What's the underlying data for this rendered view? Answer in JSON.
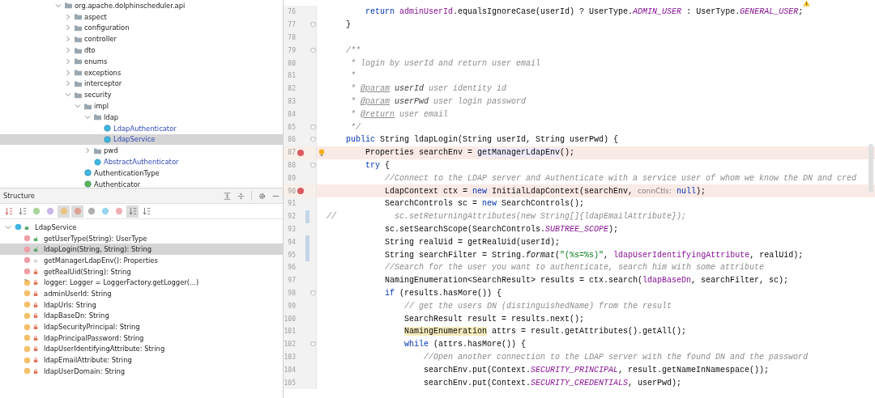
{
  "project_tree": [
    {
      "label": "org.apache.dolphinscheduler.api",
      "kind": "folder",
      "expanded": true,
      "selected": false,
      "children": [
        {
          "label": "aspect",
          "kind": "folder",
          "expanded": false,
          "selected": false
        },
        {
          "label": "configuration",
          "kind": "folder",
          "expanded": false,
          "selected": false
        },
        {
          "label": "controller",
          "kind": "folder",
          "expanded": false,
          "selected": false
        },
        {
          "label": "dto",
          "kind": "folder",
          "expanded": false,
          "selected": false
        },
        {
          "label": "enums",
          "kind": "folder",
          "expanded": false,
          "selected": false
        },
        {
          "label": "exceptions",
          "kind": "folder",
          "expanded": false,
          "selected": false
        },
        {
          "label": "interceptor",
          "kind": "folder",
          "expanded": false,
          "selected": false
        },
        {
          "label": "security",
          "kind": "folder",
          "expanded": true,
          "selected": false,
          "children": [
            {
              "label": "impl",
              "kind": "folder",
              "expanded": true,
              "selected": false,
              "children": [
                {
                  "label": "ldap",
                  "kind": "folder",
                  "expanded": true,
                  "selected": false,
                  "children": [
                    {
                      "label": "LdapAuthenticator",
                      "kind": "class",
                      "selected": false
                    },
                    {
                      "label": "LdapService",
                      "kind": "class",
                      "selected": true
                    }
                  ]
                },
                {
                  "label": "pwd",
                  "kind": "folder",
                  "expanded": false,
                  "selected": false
                },
                {
                  "label": "AbstractAuthenticator",
                  "kind": "abstract",
                  "selected": false
                }
              ]
            },
            {
              "label": "AuthenticationType",
              "kind": "enum",
              "selected": false
            },
            {
              "label": "Authenticator",
              "kind": "interface",
              "selected": false
            }
          ]
        }
      ]
    }
  ],
  "structure": {
    "title": "Structure",
    "toolbar": [
      {
        "kind": "sort-alpha",
        "selected": false
      },
      {
        "kind": "sort-visibility",
        "selected": false
      },
      {
        "kind": "inherited",
        "selected": false
      },
      {
        "kind": "properties",
        "selected": false
      },
      {
        "kind": "fields",
        "selected": true
      },
      {
        "kind": "non-public",
        "selected": true
      },
      {
        "kind": "anonymous",
        "selected": false
      },
      {
        "kind": "lambda-circle",
        "selected": false
      },
      {
        "kind": "lambda",
        "selected": false
      },
      {
        "kind": "autoscroll-to",
        "selected": true
      },
      {
        "kind": "autoscroll-from",
        "selected": false
      }
    ],
    "root": {
      "label": "LdapService",
      "expanded": true,
      "children": [
        {
          "label": "getUserType(String): UserType",
          "kind": "method",
          "public": true,
          "private": false,
          "selected": false
        },
        {
          "label": "ldapLogin(String, String): String",
          "kind": "method",
          "public": true,
          "private": false,
          "selected": true
        },
        {
          "label": "getManagerLdapEnv(): Properties",
          "kind": "method",
          "public": false,
          "private": false,
          "selected": false
        },
        {
          "label": "getRealUid(String): String",
          "kind": "method",
          "public": false,
          "private": true,
          "selected": false
        },
        {
          "label": "logger: Logger = LoggerFactory.getLogger(...)",
          "kind": "static-field",
          "public": false,
          "private": true,
          "selected": false
        },
        {
          "label": "adminUserId: String",
          "kind": "field",
          "public": false,
          "private": true,
          "selected": false
        },
        {
          "label": "ldapUrls: String",
          "kind": "field",
          "public": false,
          "private": true,
          "selected": false
        },
        {
          "label": "ldapBaseDn: String",
          "kind": "field",
          "public": false,
          "private": true,
          "selected": false
        },
        {
          "label": "ldapSecurityPrincipal: String",
          "kind": "field",
          "public": false,
          "private": true,
          "selected": false
        },
        {
          "label": "ldapPrincipalPassword: String",
          "kind": "field",
          "public": false,
          "private": true,
          "selected": false
        },
        {
          "label": "ldapUserIdentifyingAttribute: String",
          "kind": "field",
          "public": false,
          "private": true,
          "selected": false
        },
        {
          "label": "ldapEmailAttribute: String",
          "kind": "field",
          "public": false,
          "private": true,
          "selected": false
        },
        {
          "label": "ldapUserDomain: String",
          "kind": "field",
          "public": false,
          "private": true,
          "selected": false
        }
      ]
    }
  },
  "editor": {
    "lines": [
      {
        "number": "76",
        "breakpoint": false,
        "changed": false,
        "fold": false,
        "bulb": false,
        "tokens": [
          {
            "kind": "kw",
            "text": "        return"
          },
          {
            "kind": "field",
            "text": " adminUserId"
          },
          {
            "kind": "plain",
            "text": ".equalsIgnoreCase(userId) ? UserType."
          },
          {
            "kind": "static",
            "text": "ADMIN_USER"
          },
          {
            "kind": "plain",
            "text": " : UserType."
          },
          {
            "kind": "static",
            "text": "GENERAL_USER"
          },
          {
            "kind": "plain",
            "text": ";"
          }
        ]
      },
      {
        "number": "77",
        "breakpoint": false,
        "changed": false,
        "fold": true,
        "bulb": false,
        "tokens": [
          {
            "kind": "plain",
            "text": "    }"
          }
        ]
      },
      {
        "number": "78",
        "breakpoint": false,
        "changed": false,
        "fold": false,
        "bulb": false
      },
      {
        "number": "79",
        "breakpoint": false,
        "changed": false,
        "fold": true,
        "bulb": false,
        "tokens": [
          {
            "kind": "doc",
            "text": "    /**"
          }
        ]
      },
      {
        "number": "80",
        "breakpoint": false,
        "changed": false,
        "fold": false,
        "bulb": false,
        "tokens": [
          {
            "kind": "doc",
            "text": "     * login by userId and return user email"
          }
        ]
      },
      {
        "number": "81",
        "breakpoint": false,
        "changed": false,
        "fold": false,
        "bulb": false,
        "tokens": [
          {
            "kind": "doc",
            "text": "     *"
          }
        ]
      },
      {
        "number": "82",
        "breakpoint": false,
        "changed": false,
        "fold": false,
        "bulb": false,
        "tokens": [
          {
            "kind": "doc",
            "text": "     * "
          },
          {
            "kind": "doctag",
            "text": "@param"
          },
          {
            "kind": "docparam",
            "text": " userId"
          },
          {
            "kind": "doc",
            "text": " user identity id"
          }
        ]
      },
      {
        "number": "83",
        "breakpoint": false,
        "changed": false,
        "fold": false,
        "bulb": false,
        "tokens": [
          {
            "kind": "doc",
            "text": "     * "
          },
          {
            "kind": "doctag",
            "text": "@param"
          },
          {
            "kind": "docparam",
            "text": " userPwd"
          },
          {
            "kind": "doc",
            "text": " user login password"
          }
        ]
      },
      {
        "number": "84",
        "breakpoint": false,
        "changed": false,
        "fold": false,
        "bulb": false,
        "tokens": [
          {
            "kind": "doc",
            "text": "     * "
          },
          {
            "kind": "doctag",
            "text": "@return"
          },
          {
            "kind": "doc",
            "text": " user email"
          }
        ]
      },
      {
        "number": "85",
        "breakpoint": false,
        "changed": false,
        "fold": true,
        "bulb": false,
        "tokens": [
          {
            "kind": "doc",
            "text": "     */"
          }
        ]
      },
      {
        "number": "86",
        "breakpoint": false,
        "changed": false,
        "fold": true,
        "bulb": false,
        "tokens": [
          {
            "kind": "kw",
            "text": "    public"
          },
          {
            "kind": "plain",
            "text": " String ldapLogin(String userId, String userPwd) {"
          }
        ]
      },
      {
        "number": "87",
        "breakpoint": true,
        "changed": false,
        "fold": false,
        "bulb": true,
        "tokens": [
          {
            "kind": "plain",
            "text": "        Properties searchEnv = "
          },
          {
            "kind": "usage",
            "text": "getManagerLdapEnv"
          },
          {
            "kind": "plain",
            "text": "();"
          }
        ]
      },
      {
        "number": "88",
        "breakpoint": false,
        "changed": false,
        "fold": true,
        "bulb": false,
        "tokens": [
          {
            "kind": "kw",
            "text": "        try"
          },
          {
            "kind": "plain",
            "text": " {"
          }
        ]
      },
      {
        "number": "89",
        "breakpoint": false,
        "changed": false,
        "fold": false,
        "bulb": false,
        "tokens": [
          {
            "kind": "comment",
            "text": "            //Connect to the LDAP server and Authenticate with a service user of whom we know the DN and cred"
          }
        ]
      },
      {
        "number": "90",
        "breakpoint": true,
        "changed": false,
        "fold": false,
        "bulb": false,
        "tokens": [
          {
            "kind": "plain",
            "text": "            LdapContext ctx = "
          },
          {
            "kind": "kw",
            "text": "new"
          },
          {
            "kind": "plain",
            "text": " InitialLdapContext(searchEnv, "
          },
          {
            "kind": "hint",
            "text": "connCtls:"
          },
          {
            "kind": "kw",
            "text": " null"
          },
          {
            "kind": "plain",
            "text": ");"
          }
        ]
      },
      {
        "number": "91",
        "breakpoint": false,
        "changed": false,
        "fold": false,
        "bulb": false,
        "tokens": [
          {
            "kind": "plain",
            "text": "            SearchControls sc = "
          },
          {
            "kind": "kw",
            "text": "new"
          },
          {
            "kind": "plain",
            "text": " SearchControls();"
          }
        ]
      },
      {
        "number": "92",
        "breakpoint": false,
        "changed": true,
        "fold": false,
        "bulb": false,
        "tokens": [
          {
            "kind": "comment",
            "text": "//            sc.setReturningAttributes(new String[]{ldapEmailAttribute});"
          }
        ]
      },
      {
        "number": "93",
        "breakpoint": false,
        "changed": false,
        "fold": false,
        "bulb": false,
        "tokens": [
          {
            "kind": "plain",
            "text": "            sc.setSearchScope(SearchControls."
          },
          {
            "kind": "static",
            "text": "SUBTREE_SCOPE"
          },
          {
            "kind": "plain",
            "text": ");"
          }
        ]
      },
      {
        "number": "94",
        "breakpoint": false,
        "changed": true,
        "fold": false,
        "bulb": false,
        "tokens": [
          {
            "kind": "plain",
            "text": "            String realUid = getRealUid(userId);"
          }
        ]
      },
      {
        "number": "95",
        "breakpoint": false,
        "changed": true,
        "fold": false,
        "bulb": false,
        "tokens": [
          {
            "kind": "plain",
            "text": "            String searchFilter = String."
          },
          {
            "kind": "italic",
            "text": "format"
          },
          {
            "kind": "plain",
            "text": "("
          },
          {
            "kind": "string",
            "text": "\"(%s=%s)\""
          },
          {
            "kind": "plain",
            "text": ", "
          },
          {
            "kind": "field",
            "text": "ldapUserIdentifyingAttribute"
          },
          {
            "kind": "plain",
            "text": ", realUid);"
          }
        ]
      },
      {
        "number": "96",
        "breakpoint": false,
        "changed": false,
        "fold": false,
        "bulb": false,
        "tokens": [
          {
            "kind": "comment",
            "text": "            //Search for the user you want to authenticate, search him with some attribute"
          }
        ]
      },
      {
        "number": "97",
        "breakpoint": false,
        "changed": false,
        "fold": false,
        "bulb": false,
        "tokens": [
          {
            "kind": "plain",
            "text": "            NamingEnumeration<SearchResult> results = ctx.search("
          },
          {
            "kind": "field",
            "text": "ldapBaseDn"
          },
          {
            "kind": "plain",
            "text": ", searchFilter, sc);"
          }
        ]
      },
      {
        "number": "98",
        "breakpoint": false,
        "changed": false,
        "fold": true,
        "bulb": false,
        "tokens": [
          {
            "kind": "kw",
            "text": "            if"
          },
          {
            "kind": "plain",
            "text": " (results.hasMore()) {"
          }
        ]
      },
      {
        "number": "99",
        "breakpoint": false,
        "changed": false,
        "fold": false,
        "bulb": false,
        "tokens": [
          {
            "kind": "comment",
            "text": "                // get the users DN (distinguishedName) from the result"
          }
        ]
      },
      {
        "number": "100",
        "breakpoint": false,
        "changed": false,
        "fold": false,
        "bulb": false,
        "tokens": [
          {
            "kind": "plain",
            "text": "                SearchResult result = results.next();"
          }
        ]
      },
      {
        "number": "101",
        "breakpoint": false,
        "changed": false,
        "fold": false,
        "bulb": false,
        "tokens": [
          {
            "kind": "warning",
            "text": "                NamingEnumeration"
          },
          {
            "kind": "plain",
            "text": " attrs = result.getAttributes().getAll();"
          }
        ]
      },
      {
        "number": "102",
        "breakpoint": false,
        "changed": false,
        "fold": true,
        "bulb": false,
        "tokens": [
          {
            "kind": "kw",
            "text": "                while"
          },
          {
            "kind": "plain",
            "text": " (attrs.hasMore()) {"
          }
        ]
      },
      {
        "number": "103",
        "breakpoint": false,
        "changed": false,
        "fold": false,
        "bulb": false,
        "tokens": [
          {
            "kind": "comment",
            "text": "                    //Open another connection to the LDAP server with the found DN and the password"
          }
        ]
      },
      {
        "number": "104",
        "breakpoint": false,
        "changed": false,
        "fold": false,
        "bulb": false,
        "tokens": [
          {
            "kind": "plain",
            "text": "                    searchEnv.put(Context."
          },
          {
            "kind": "static",
            "text": "SECURITY_PRINCIPAL"
          },
          {
            "kind": "plain",
            "text": ", result.getNameInNamespace());"
          }
        ]
      },
      {
        "number": "105",
        "breakpoint": false,
        "changed": false,
        "fold": false,
        "bulb": false,
        "tokens": [
          {
            "kind": "plain",
            "text": "                    searchEnv.put(Context."
          },
          {
            "kind": "static",
            "text": "SECURITY_CREDENTIALS"
          },
          {
            "kind": "plain",
            "text": ", userPwd);"
          }
        ]
      }
    ]
  }
}
